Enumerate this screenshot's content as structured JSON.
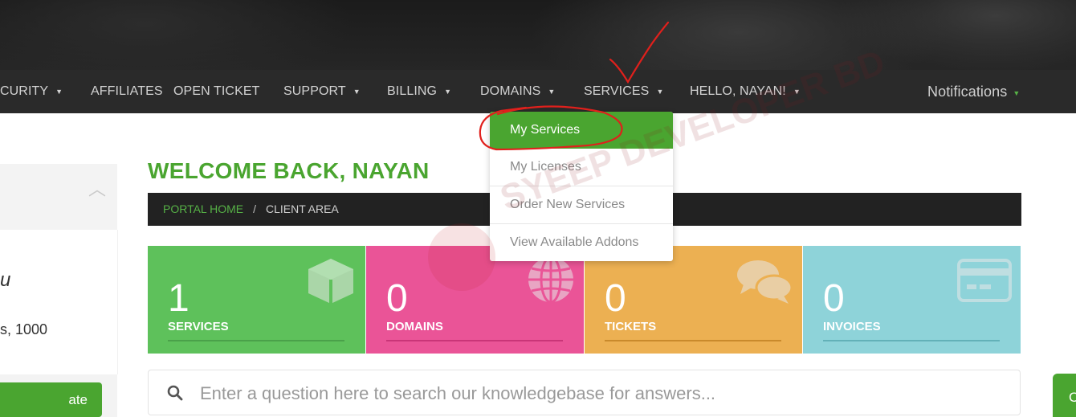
{
  "nav": {
    "items": [
      {
        "label": "CURITY",
        "caret": true
      },
      {
        "label": "AFFILIATES",
        "caret": false
      },
      {
        "label": "OPEN TICKET",
        "caret": false
      },
      {
        "label": "SUPPORT",
        "caret": true
      },
      {
        "label": "BILLING",
        "caret": true
      },
      {
        "label": "DOMAINS",
        "caret": true
      },
      {
        "label": "SERVICES",
        "caret": true
      },
      {
        "label": "HELLO, NAYAN!",
        "caret": true
      }
    ],
    "notifications": "Notifications"
  },
  "services_dropdown": {
    "items": [
      "My Services",
      "My Licenses",
      "Order New Services",
      "View Available Addons"
    ],
    "active": "My Services"
  },
  "watermark": {
    "text": "SYEEP DEVELOPER BD"
  },
  "sidebar": {
    "name_fragment": "u",
    "address_fragment": "s, 1000",
    "button_fragment": "ate"
  },
  "page": {
    "welcome": "WELCOME BACK, NAYAN",
    "breadcrumb": {
      "home": "PORTAL HOME",
      "separator": "/",
      "current": "CLIENT AREA"
    }
  },
  "tiles": [
    {
      "count": "1",
      "label": "SERVICES",
      "color": "#5ec15b",
      "line": "#4aa14a",
      "icon": "cube-icon"
    },
    {
      "count": "0",
      "label": "DOMAINS",
      "color": "#ea5497",
      "line": "#c93578",
      "icon": "globe-icon"
    },
    {
      "count": "0",
      "label": "TICKETS",
      "color": "#ecb052",
      "line": "#c98a2c",
      "icon": "comments-icon"
    },
    {
      "count": "0",
      "label": "INVOICES",
      "color": "#8ed3d9",
      "line": "#63b1b8",
      "icon": "credit-card-icon"
    }
  ],
  "search": {
    "placeholder": "Enter a question here to search our knowledgebase for answers..."
  },
  "right_tab": {
    "label": "C"
  },
  "colors": {
    "accent": "#4aa530",
    "nav_bg": "#2a2a2a",
    "annotation": "#e0201c"
  }
}
